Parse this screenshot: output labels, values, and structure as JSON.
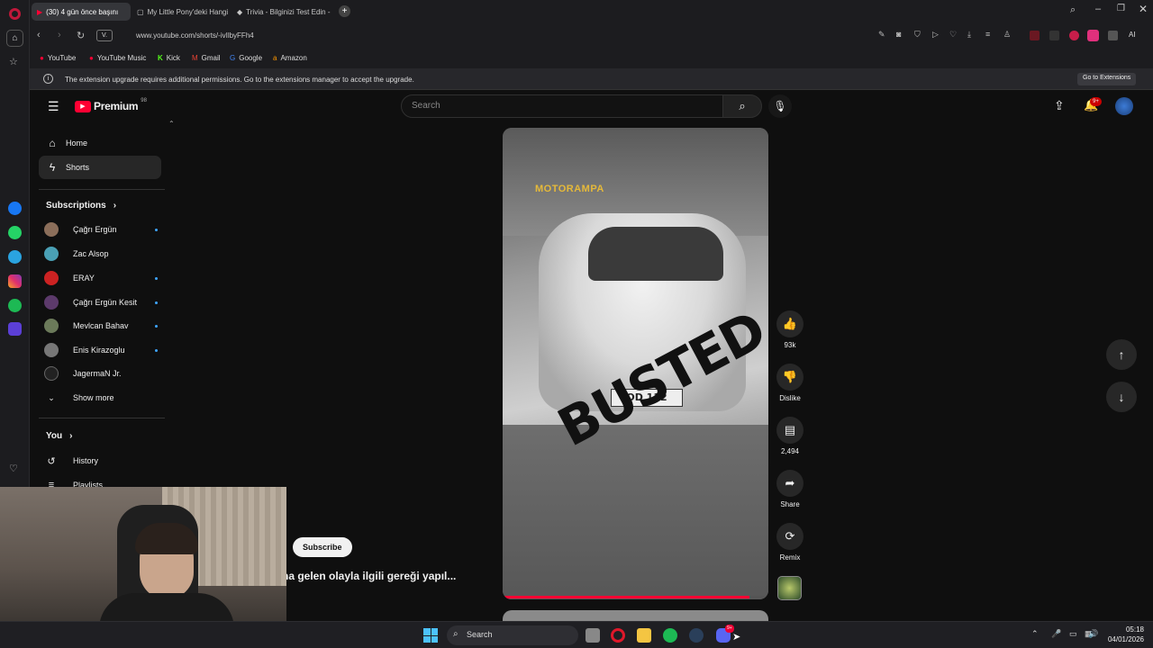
{
  "browser": {
    "tabs": [
      {
        "label": "(30) 4 gün önce başını",
        "active": true
      },
      {
        "label": "My Little Pony'deki Hangi",
        "active": false
      },
      {
        "label": "Trivia - Bilginizi Test Edin -",
        "active": false
      }
    ],
    "url": "www.youtube.com/shorts/-ivIlbyFFh4",
    "site_badge": "V.",
    "ai_label": "AI",
    "bookmarks": [
      "YouTube",
      "YouTube Music",
      "Kick",
      "Gmail",
      "Google",
      "Amazon"
    ],
    "info_message": "The extension upgrade requires additional permissions. Go to the extensions manager to accept the upgrade.",
    "info_button": "Go to Extensions"
  },
  "youtube": {
    "logo": "Premium",
    "logo_sup": "98",
    "search_placeholder": "Search",
    "notif_count": "9+",
    "nav": {
      "home": "Home",
      "shorts": "Shorts"
    },
    "subscriptions_title": "Subscriptions",
    "subscriptions": [
      {
        "name": "Çağrı Ergün",
        "dot": true
      },
      {
        "name": "Zac Alsop",
        "dot": false
      },
      {
        "name": "ERAY",
        "dot": true
      },
      {
        "name": "Çağrı Ergün Kesit",
        "dot": true
      },
      {
        "name": "Mevlcan Bahav",
        "dot": true
      },
      {
        "name": "Enis Kirazoglu",
        "dot": true
      },
      {
        "name": "JagermaN Jr.",
        "dot": false
      }
    ],
    "show_more": "Show more",
    "you_title": "You",
    "history": "History",
    "playlists": "Playlists",
    "short": {
      "watermark": "MOTORAMPA",
      "overlay_text": "BUSTED",
      "plate": "OD 112",
      "subscribe": "Subscribe",
      "title": "na gelen olayla ilgili gereği yapıl...",
      "progress": 0.93
    },
    "actions": {
      "likes": "93k",
      "dislike": "Dislike",
      "comments": "2,494",
      "share": "Share",
      "remix": "Remix"
    }
  },
  "taskbar": {
    "search": "Search",
    "time": "05:18",
    "date": "04/01/2026",
    "badge": "9+"
  }
}
